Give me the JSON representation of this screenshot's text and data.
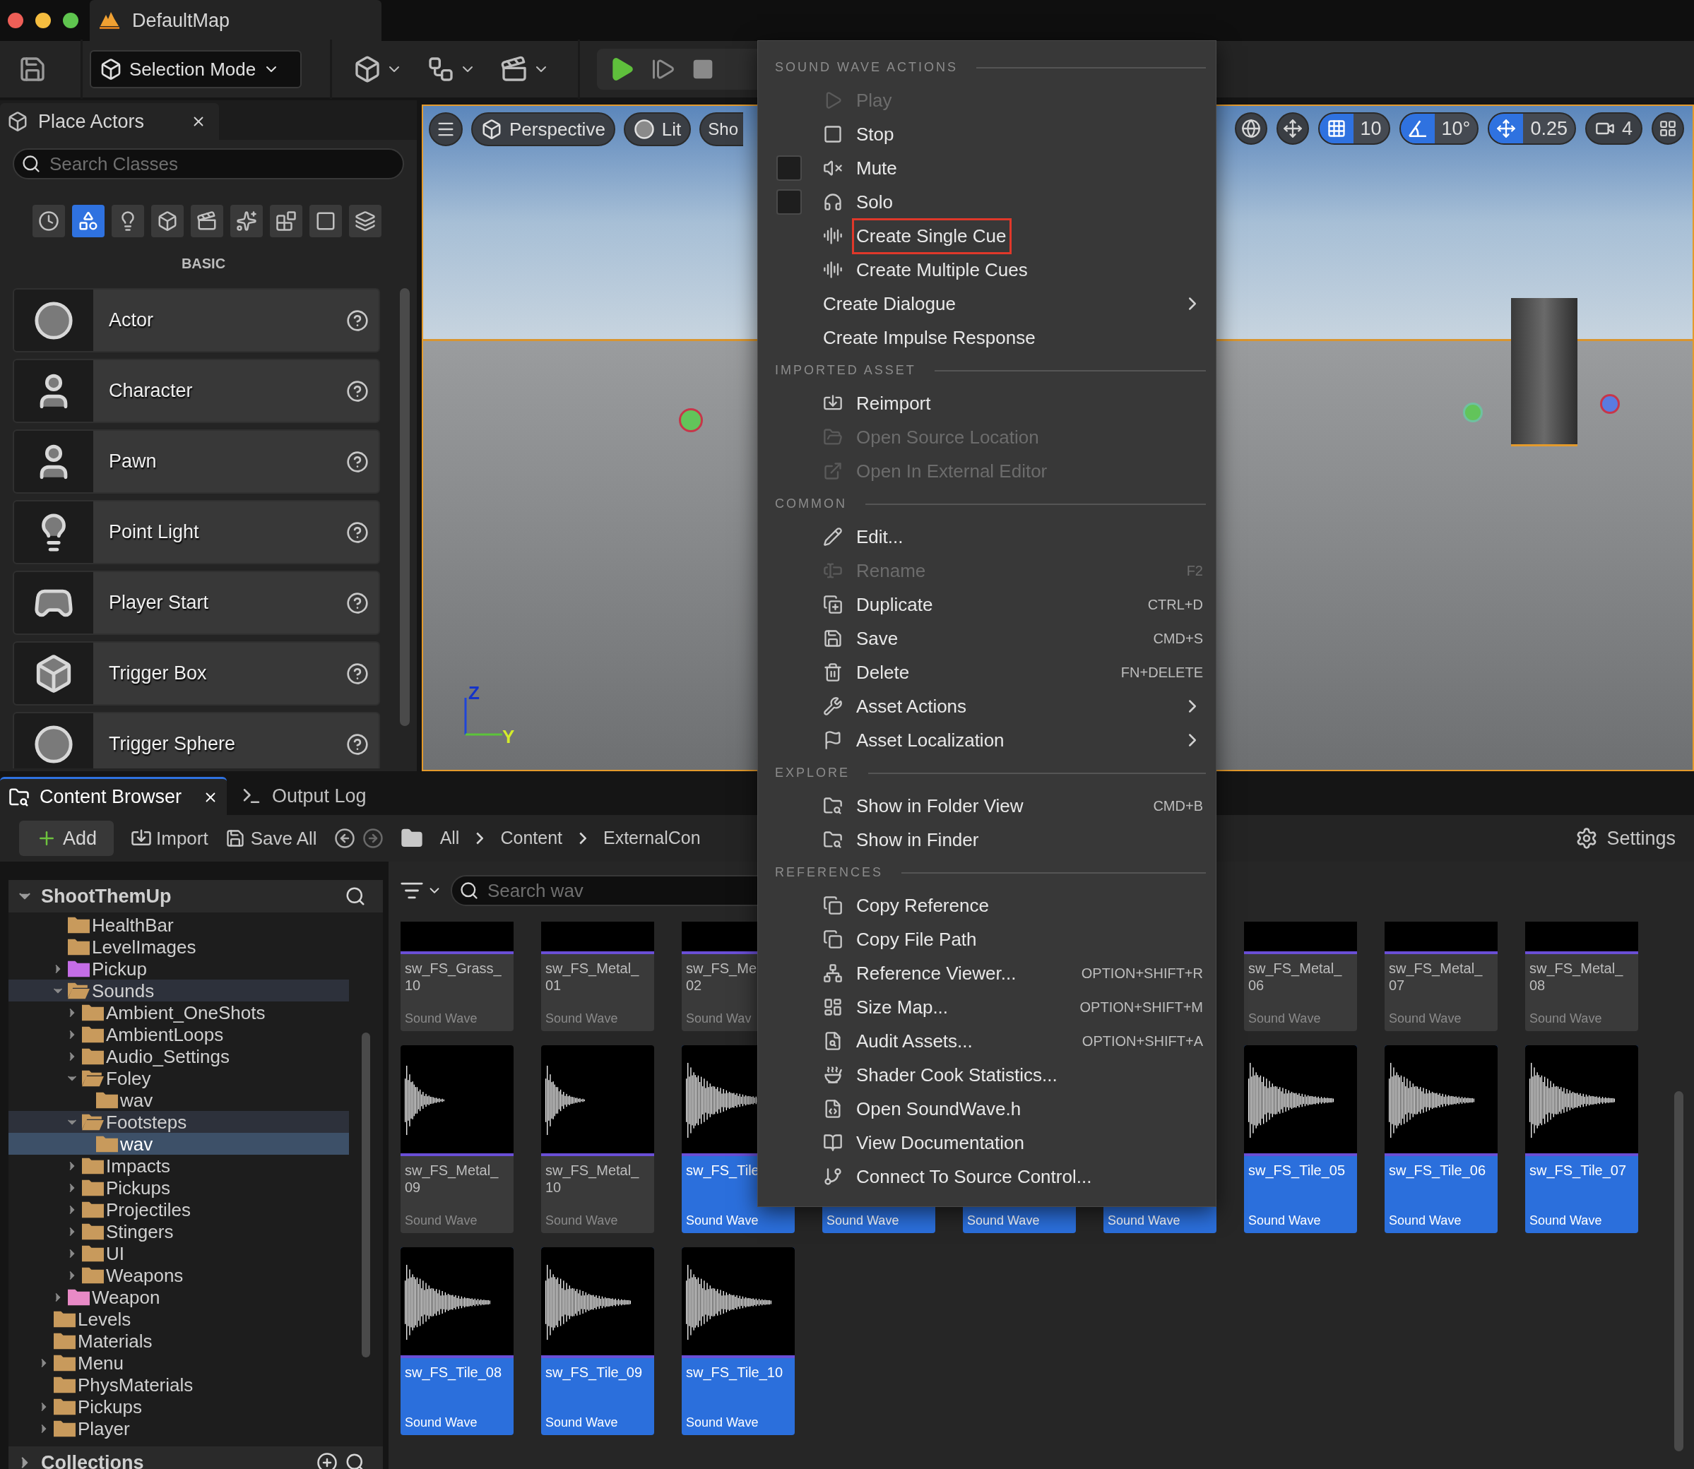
{
  "window": {
    "title": "DefaultMap"
  },
  "toolbar": {
    "mode": "Selection Mode"
  },
  "place_actors": {
    "tab": "Place Actors",
    "search": {
      "placeholder": "Search Classes"
    },
    "categories": [
      {
        "selected": false
      },
      {
        "selected": true
      },
      {
        "selected": false
      },
      {
        "selected": false
      },
      {
        "selected": false
      },
      {
        "selected": false
      },
      {
        "selected": false
      },
      {
        "selected": false
      },
      {
        "selected": false
      }
    ],
    "category_label": "BASIC",
    "items": [
      {
        "label": "Actor"
      },
      {
        "label": "Character"
      },
      {
        "label": "Pawn"
      },
      {
        "label": "Point Light"
      },
      {
        "label": "Player Start"
      },
      {
        "label": "Trigger Box"
      },
      {
        "label": "Trigger Sphere"
      }
    ]
  },
  "viewport": {
    "view": "Perspective",
    "lighting": "Lit",
    "show": "Sho",
    "snaps": [
      {
        "value": "10",
        "on": true
      },
      {
        "value": "10°",
        "on": true
      },
      {
        "value": "0.25",
        "on": true
      }
    ],
    "camera_speed": "4",
    "axes": [
      "Z",
      "Y"
    ]
  },
  "content_browser": {
    "tabs": [
      {
        "label": "Content Browser",
        "selected": true,
        "closable": true
      },
      {
        "label": "Output Log",
        "selected": false,
        "closable": false
      }
    ],
    "buttons": [
      "Add",
      "Import",
      "Save All"
    ],
    "breadcrumb": [
      "All",
      "Content",
      "ExternalCon"
    ],
    "settings": "Settings",
    "search": {
      "placeholder": "Search wav"
    },
    "tree": {
      "root": "ShootThemUp",
      "scrolled_branch": [
        {
          "label": "HealthBar",
          "color": "#c89a5c",
          "expandable": false,
          "expanded": false,
          "selected": false,
          "highlighted": false
        },
        {
          "label": "LevelImages",
          "color": "#c89a5c",
          "expandable": false,
          "expanded": false,
          "selected": false,
          "highlighted": false
        },
        {
          "label": "Pickup",
          "color": "#c46de6",
          "expandable": true,
          "expanded": false,
          "selected": false,
          "highlighted": false
        },
        {
          "label": "Sounds",
          "color": "#c89a5c",
          "expandable": true,
          "expanded": true,
          "selected": false,
          "highlighted": true,
          "children": [
            {
              "label": "Ambient_OneShots",
              "color": "#c89a5c",
              "expandable": true,
              "expanded": false,
              "selected": false,
              "highlighted": false
            },
            {
              "label": "AmbientLoops",
              "color": "#c89a5c",
              "expandable": true,
              "expanded": false,
              "selected": false,
              "highlighted": false
            },
            {
              "label": "Audio_Settings",
              "color": "#c89a5c",
              "expandable": true,
              "expanded": false,
              "selected": false,
              "highlighted": false
            },
            {
              "label": "Foley",
              "color": "#c89a5c",
              "expandable": true,
              "expanded": true,
              "selected": false,
              "highlighted": false,
              "children": [
                {
                  "label": "wav",
                  "color": "#c89a5c",
                  "expandable": false,
                  "expanded": false,
                  "selected": false,
                  "highlighted": false
                }
              ]
            },
            {
              "label": "Footsteps",
              "color": "#c89a5c",
              "expandable": true,
              "expanded": true,
              "selected": false,
              "highlighted": true,
              "children": [
                {
                  "label": "wav",
                  "color": "#c89a5c",
                  "expandable": false,
                  "expanded": false,
                  "selected": true,
                  "highlighted": false
                }
              ]
            },
            {
              "label": "Impacts",
              "color": "#c89a5c",
              "expandable": true,
              "expanded": false,
              "selected": false,
              "highlighted": false
            },
            {
              "label": "Pickups",
              "color": "#c89a5c",
              "expandable": true,
              "expanded": false,
              "selected": false,
              "highlighted": false
            },
            {
              "label": "Projectiles",
              "color": "#c89a5c",
              "expandable": true,
              "expanded": false,
              "selected": false,
              "highlighted": false
            },
            {
              "label": "Stingers",
              "color": "#c89a5c",
              "expandable": true,
              "expanded": false,
              "selected": false,
              "highlighted": false
            },
            {
              "label": "UI",
              "color": "#c89a5c",
              "expandable": true,
              "expanded": false,
              "selected": false,
              "highlighted": false
            },
            {
              "label": "Weapons",
              "color": "#c89a5c",
              "expandable": true,
              "expanded": false,
              "selected": false,
              "highlighted": false
            }
          ]
        },
        {
          "label": "Weapon",
          "color": "#e88ac6",
          "expandable": true,
          "expanded": false,
          "selected": false,
          "highlighted": false
        }
      ],
      "items": [
        {
          "label": "Levels",
          "color": "#c89a5c",
          "expandable": false,
          "expanded": false,
          "selected": false,
          "highlighted": false
        },
        {
          "label": "Materials",
          "color": "#c89a5c",
          "expandable": false,
          "expanded": false,
          "selected": false,
          "highlighted": false
        },
        {
          "label": "Menu",
          "color": "#c89a5c",
          "expandable": true,
          "expanded": false,
          "selected": false,
          "highlighted": false
        },
        {
          "label": "PhysMaterials",
          "color": "#c89a5c",
          "expandable": false,
          "expanded": false,
          "selected": false,
          "highlighted": false
        },
        {
          "label": "Pickups",
          "color": "#c89a5c",
          "expandable": true,
          "expanded": false,
          "selected": false,
          "highlighted": false
        },
        {
          "label": "Player",
          "color": "#c89a5c",
          "expandable": true,
          "expanded": false,
          "selected": false,
          "highlighted": false
        }
      ]
    },
    "collections": "Collections",
    "assets": {
      "rows": [
        {
          "start": [
            {
              "name_lines": [
                "sw_FS_Grass_",
                "10"
              ],
              "type": "Sound Wave",
              "selected": false,
              "thumbnail": true
            },
            {
              "name_lines": [
                "sw_FS_Metal_",
                "01"
              ],
              "type": "Sound Wave",
              "selected": false,
              "thumbnail": true
            },
            {
              "name_lines": [
                "sw_FS_Me",
                "02"
              ],
              "type": "Sound Wav",
              "selected": false,
              "thumbnail": true
            }
          ],
          "end": [
            {
              "name_lines": [
                "sw_FS_Metal_",
                "06"
              ],
              "type": "Sound Wave",
              "selected": false,
              "thumbnail": true
            },
            {
              "name_lines": [
                "sw_FS_Metal_",
                "07"
              ],
              "type": "Sound Wave",
              "selected": false,
              "thumbnail": true
            },
            {
              "name_lines": [
                "sw_FS_Metal_",
                "08"
              ],
              "type": "Sound Wave",
              "selected": false,
              "thumbnail": true
            }
          ]
        },
        {
          "start": [
            {
              "name_lines": [
                "sw_FS_Metal_",
                "09"
              ],
              "type": "Sound Wave",
              "selected": false,
              "thumbnail": true,
              "kind": "short"
            },
            {
              "name_lines": [
                "sw_FS_Metal_",
                "10"
              ],
              "type": "Sound Wave",
              "selected": false,
              "thumbnail": true,
              "kind": "short"
            },
            {
              "name_lines": [
                "sw_FS_Tile"
              ],
              "type": "Sound Wave",
              "selected": true,
              "thumbnail": true,
              "kind": "long"
            },
            {
              "type": "Sound Wave",
              "selected": true,
              "thumbnail": false
            },
            {
              "type": "Sound Wave",
              "selected": true,
              "thumbnail": false
            },
            {
              "type": "Sound Wave",
              "selected": true,
              "thumbnail": false
            },
            {
              "name_lines": [
                "sw_FS_Tile_05"
              ],
              "type": "Sound Wave",
              "selected": true,
              "thumbnail": true,
              "kind": "long"
            },
            {
              "name_lines": [
                "sw_FS_Tile_06"
              ],
              "type": "Sound Wave",
              "selected": true,
              "thumbnail": true,
              "kind": "long"
            },
            {
              "name_lines": [
                "sw_FS_Tile_07"
              ],
              "type": "Sound Wave",
              "selected": true,
              "thumbnail": true,
              "kind": "long"
            }
          ],
          "end": []
        },
        {
          "start": [
            {
              "name_lines": [
                "sw_FS_Tile_08"
              ],
              "type": "Sound Wave",
              "selected": true,
              "thumbnail": true,
              "kind": "long"
            },
            {
              "name_lines": [
                "sw_FS_Tile_09"
              ],
              "type": "Sound Wave",
              "selected": true,
              "thumbnail": true,
              "kind": "long"
            },
            {
              "name_lines": [
                "sw_FS_Tile_10"
              ],
              "type": "Sound Wave",
              "selected": true,
              "thumbnail": true,
              "kind": "long"
            }
          ],
          "end": []
        }
      ]
    }
  },
  "context_menu": {
    "sections": [
      {
        "title": "SOUND WAVE ACTIONS",
        "items": [
          {
            "label": "Play",
            "kind": "icon",
            "disabled": true,
            "highlighted": false,
            "submenu": false
          },
          {
            "label": "Stop",
            "kind": "icon",
            "disabled": false,
            "highlighted": false,
            "submenu": false
          },
          {
            "label": "Mute",
            "kind": "check",
            "checked": false,
            "disabled": false,
            "highlighted": false,
            "submenu": false
          },
          {
            "label": "Solo",
            "kind": "check",
            "checked": false,
            "disabled": false,
            "highlighted": false,
            "submenu": false
          },
          {
            "label": "Create Single Cue",
            "kind": "icon",
            "disabled": false,
            "highlighted": true,
            "submenu": false
          },
          {
            "label": "Create Multiple Cues",
            "kind": "icon",
            "disabled": false,
            "highlighted": false,
            "submenu": false
          },
          {
            "label": "Create Dialogue",
            "kind": "text",
            "disabled": false,
            "highlighted": false,
            "submenu": true
          },
          {
            "label": "Create Impulse Response",
            "kind": "text",
            "disabled": false,
            "highlighted": false,
            "submenu": false
          }
        ]
      },
      {
        "title": "IMPORTED ASSET",
        "items": [
          {
            "label": "Reimport",
            "kind": "icon",
            "disabled": false,
            "highlighted": false,
            "submenu": false
          },
          {
            "label": "Open Source Location",
            "kind": "icon",
            "disabled": true,
            "highlighted": false,
            "submenu": false
          },
          {
            "label": "Open In External Editor",
            "kind": "icon",
            "disabled": true,
            "highlighted": false,
            "submenu": false
          }
        ]
      },
      {
        "title": "COMMON",
        "items": [
          {
            "label": "Edit...",
            "kind": "icon",
            "disabled": false,
            "highlighted": false,
            "submenu": false
          },
          {
            "label": "Rename",
            "kind": "icon",
            "shortcut": "F2",
            "disabled": true,
            "highlighted": false,
            "submenu": false
          },
          {
            "label": "Duplicate",
            "kind": "icon",
            "shortcut": "CTRL+D",
            "disabled": false,
            "highlighted": false,
            "submenu": false
          },
          {
            "label": "Save",
            "kind": "icon",
            "shortcut": "CMD+S",
            "disabled": false,
            "highlighted": false,
            "submenu": false
          },
          {
            "label": "Delete",
            "kind": "icon",
            "shortcut": "FN+DELETE",
            "disabled": false,
            "highlighted": false,
            "submenu": false
          },
          {
            "label": "Asset Actions",
            "kind": "icon",
            "disabled": false,
            "highlighted": false,
            "submenu": true
          },
          {
            "label": "Asset Localization",
            "kind": "icon",
            "disabled": false,
            "highlighted": false,
            "submenu": true
          }
        ]
      },
      {
        "title": "EXPLORE",
        "items": [
          {
            "label": "Show in Folder View",
            "kind": "icon",
            "shortcut": "CMD+B",
            "disabled": false,
            "highlighted": false,
            "submenu": false
          },
          {
            "label": "Show in Finder",
            "kind": "icon",
            "disabled": false,
            "highlighted": false,
            "submenu": false
          }
        ]
      },
      {
        "title": "REFERENCES",
        "items": [
          {
            "label": "Copy Reference",
            "kind": "icon",
            "disabled": false,
            "highlighted": false,
            "submenu": false
          },
          {
            "label": "Copy File Path",
            "kind": "icon",
            "disabled": false,
            "highlighted": false,
            "submenu": false
          },
          {
            "label": "Reference Viewer...",
            "kind": "icon",
            "shortcut": "OPTION+SHIFT+R",
            "disabled": false,
            "highlighted": false,
            "submenu": false
          },
          {
            "label": "Size Map...",
            "kind": "icon",
            "shortcut": "OPTION+SHIFT+M",
            "disabled": false,
            "highlighted": false,
            "submenu": false
          },
          {
            "label": "Audit Assets...",
            "kind": "icon",
            "shortcut": "OPTION+SHIFT+A",
            "disabled": false,
            "highlighted": false,
            "submenu": false
          },
          {
            "label": "Shader Cook Statistics...",
            "kind": "icon",
            "disabled": false,
            "highlighted": false,
            "submenu": false
          },
          {
            "label": "Open SoundWave.h",
            "kind": "icon",
            "disabled": false,
            "highlighted": false,
            "submenu": false
          },
          {
            "label": "View Documentation",
            "kind": "icon",
            "disabled": false,
            "highlighted": false,
            "submenu": false
          },
          {
            "label": "Connect To Source Control...",
            "kind": "icon",
            "disabled": false,
            "highlighted": false,
            "submenu": false
          }
        ]
      }
    ]
  }
}
